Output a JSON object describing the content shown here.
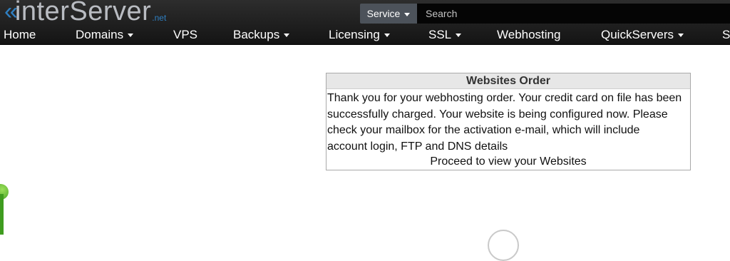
{
  "brand": {
    "name": "interServer",
    "suffix": ".net",
    "logo_color": "#2f7fc1"
  },
  "header": {
    "service_label": "Service",
    "search_placeholder": "Search"
  },
  "nav": {
    "items": [
      {
        "label": "Home",
        "dropdown": false
      },
      {
        "label": "Domains",
        "dropdown": true
      },
      {
        "label": "VPS",
        "dropdown": false
      },
      {
        "label": "Backups",
        "dropdown": true
      },
      {
        "label": "Licensing",
        "dropdown": true
      },
      {
        "label": "SSL",
        "dropdown": true
      },
      {
        "label": "Webhosting",
        "dropdown": false
      },
      {
        "label": "QuickServers",
        "dropdown": true
      },
      {
        "label": "Se",
        "dropdown": false
      }
    ]
  },
  "order": {
    "title": "Websites Order",
    "message_lines": [
      "Thank you for your webhosting order. Your credit card on file has been",
      "successfully charged. Your website is being configured now. Please",
      "check your mailbox for the activation e-mail, which will include",
      "account login, FTP and DNS details"
    ],
    "proceed_link": "Proceed to view your Websites"
  },
  "colors": {
    "topbar": "#1e1e1e",
    "service_button": "#4c525a",
    "box_border": "#a9a9a9",
    "widget_green": "#3f9c1f"
  }
}
